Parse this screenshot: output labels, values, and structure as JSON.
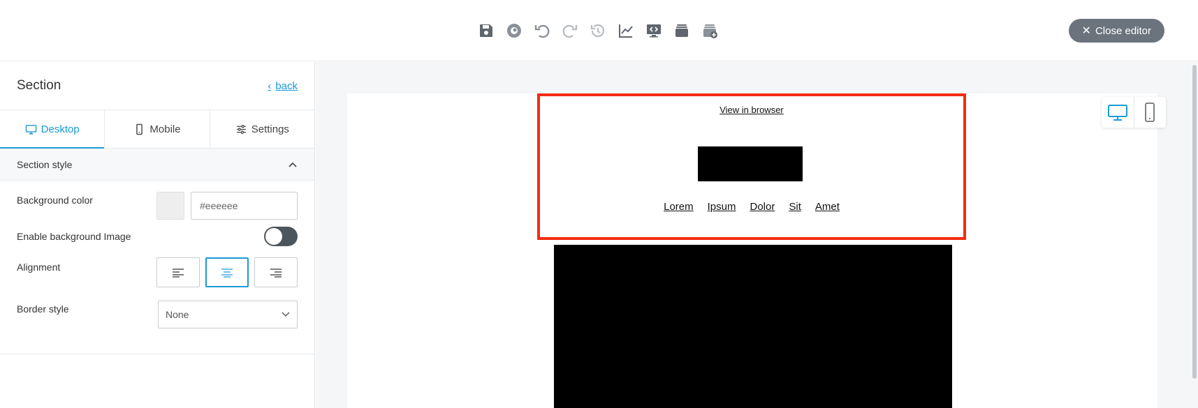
{
  "toolbar": {
    "icons": [
      "save-icon",
      "preview-icon",
      "undo-icon",
      "redo-icon",
      "history-icon",
      "chart-icon",
      "code-icon",
      "layers-icon",
      "add-layer-icon"
    ],
    "close_label": "Close editor"
  },
  "sidebar": {
    "title": "Section",
    "back_label": "back",
    "tabs": [
      {
        "label": "Desktop",
        "icon": "desktop-icon",
        "active": true
      },
      {
        "label": "Mobile",
        "icon": "mobile-icon",
        "active": false
      },
      {
        "label": "Settings",
        "icon": "sliders-icon",
        "active": false
      }
    ],
    "section_style": {
      "title": "Section style",
      "background_color_label": "Background color",
      "background_color_value": "#eeeeee",
      "enable_bg_image_label": "Enable background Image",
      "alignment_label": "Alignment",
      "alignment_selected": "center",
      "border_style_label": "Border style",
      "border_style_value": "None"
    }
  },
  "canvas": {
    "view_in_browser": "View in browser",
    "nav_links": [
      "Lorem",
      "Ipsum",
      "Dolor",
      "Sit",
      "Amet"
    ],
    "device_active": "desktop"
  },
  "colors": {
    "accent": "#1a9ad6",
    "selection_border": "#f42c0f",
    "close_button": "#6b747d",
    "toggle": "#4d555c"
  }
}
